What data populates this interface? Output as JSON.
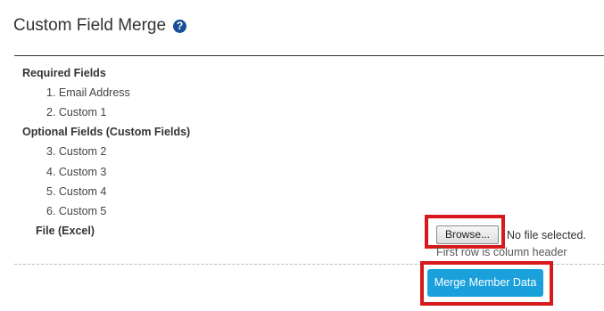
{
  "header": {
    "title": "Custom Field Merge",
    "help_icon": "?"
  },
  "required": {
    "heading": "Required Fields",
    "items": [
      {
        "label": "1. Email Address"
      },
      {
        "label": "2. Custom 1"
      }
    ]
  },
  "optional": {
    "heading": "Optional Fields (Custom Fields)",
    "items": [
      {
        "label": "3. Custom 2"
      },
      {
        "label": "4. Custom 3"
      },
      {
        "label": "5. Custom 4"
      },
      {
        "label": "6. Custom 5"
      }
    ]
  },
  "file": {
    "label": "File (Excel)",
    "browse_label": "Browse...",
    "status": "No file selected.",
    "hint": "First row is column header"
  },
  "actions": {
    "merge_label": "Merge Member Data"
  },
  "colors": {
    "accent": "#1aa1dc",
    "highlight": "#d7191c",
    "help_icon_bg": "#1a4f9a"
  }
}
